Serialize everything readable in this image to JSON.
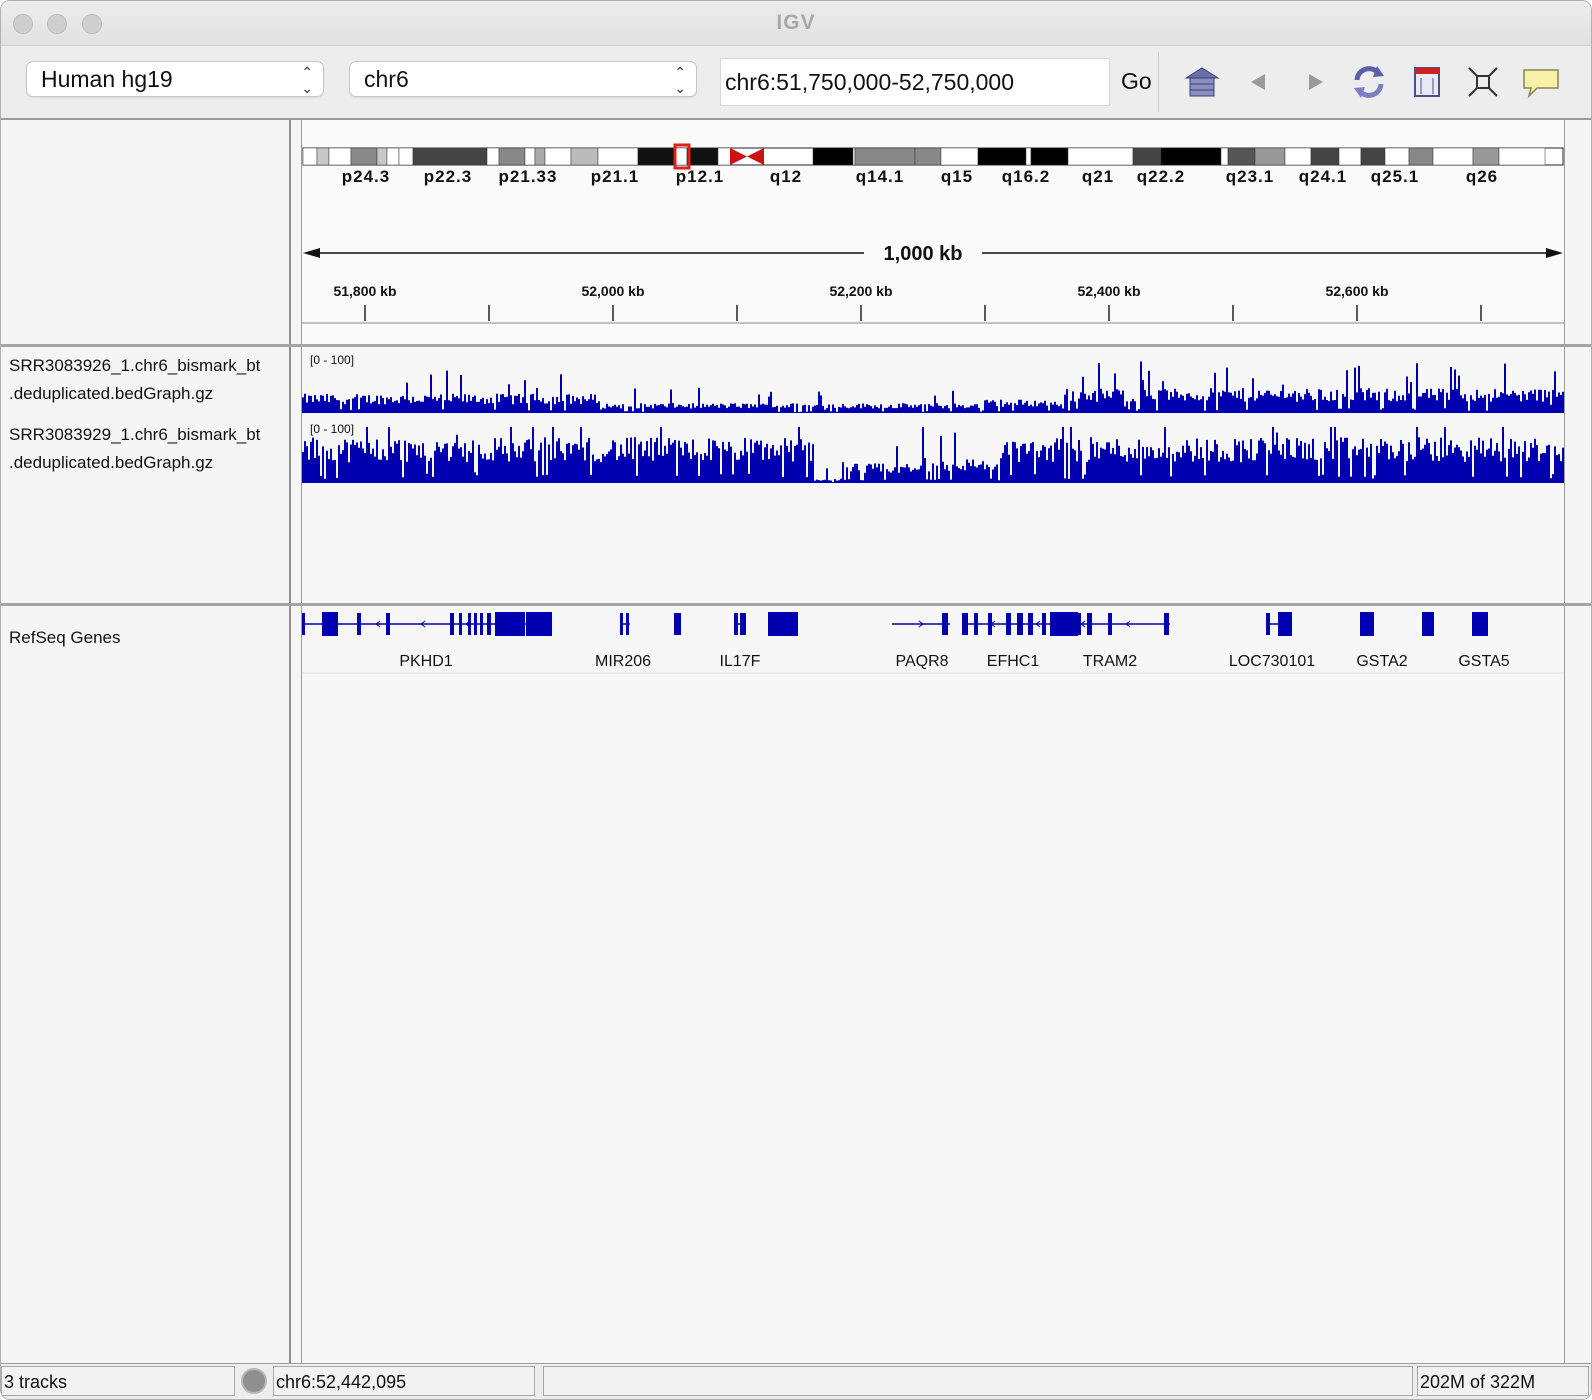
{
  "window": {
    "title": "IGV"
  },
  "toolbar": {
    "genome": "Human hg19",
    "chromosome": "chr6",
    "locus": "chr6:51,750,000-52,750,000",
    "go_label": "Go",
    "icons": [
      "home-icon",
      "back-arrow-icon",
      "forward-arrow-icon",
      "refresh-icon",
      "roi-icon",
      "fit-window-icon",
      "popup-text-icon"
    ]
  },
  "ideogram": {
    "bands": [
      "p24.3",
      "p22.3",
      "p21.33",
      "p21.1",
      "p12.1",
      "q12",
      "q14.1",
      "q15",
      "q16.2",
      "q21",
      "q22.2",
      "q23.1",
      "q24.1",
      "q25.1",
      "q26"
    ]
  },
  "ruler": {
    "span_label": "1,000 kb",
    "ticks": [
      "51,800 kb",
      "52,000 kb",
      "52,200 kb",
      "52,400 kb",
      "52,600 kb"
    ]
  },
  "tracks": [
    {
      "name_line1": "SRR3083926_1.chr6_bismark_bt",
      "name_line2": ".deduplicated.bedGraph.gz",
      "range": "[0 - 100]"
    },
    {
      "name_line1": "SRR3083929_1.chr6_bismark_bt",
      "name_line2": ".deduplicated.bedGraph.gz",
      "range": "[0 - 100]"
    }
  ],
  "genes_track": {
    "name": "RefSeq Genes",
    "genes": [
      "PKHD1",
      "MIR206",
      "IL17F",
      "PAQR8",
      "EFHC1",
      "TRAM2",
      "LOC730101",
      "GSTA2",
      "GSTA5"
    ]
  },
  "colors": {
    "signal": "#0000b0",
    "centromere": "#cc1111",
    "highlight": "#e0201a"
  },
  "statusbar": {
    "tracks": "3 tracks",
    "position": "chr6:52,442,095",
    "memory": "202M of 322M"
  }
}
